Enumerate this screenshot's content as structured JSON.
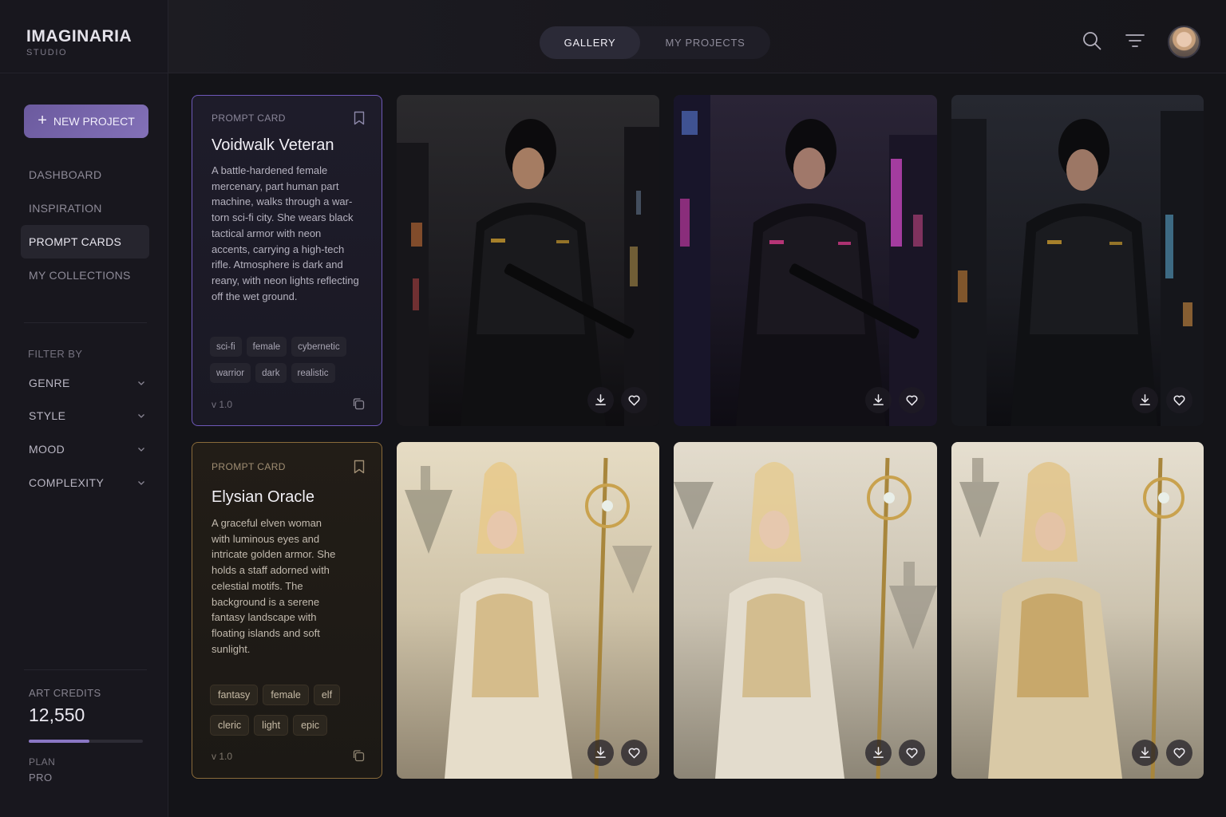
{
  "brand": {
    "name": "IMAGINARIA",
    "sub": "STUDIO"
  },
  "sidebar": {
    "new_project_label": "NEW PROJECT",
    "nav": [
      {
        "label": "DASHBOARD",
        "active": false
      },
      {
        "label": "INSPIRATION",
        "active": false
      },
      {
        "label": "PROMPT CARDS",
        "active": true
      },
      {
        "label": "MY COLLECTIONS",
        "active": false
      }
    ],
    "filter_title": "FILTER BY",
    "filters": [
      "GENRE",
      "STYLE",
      "MOOD",
      "COMPLEXITY"
    ],
    "credits_label": "ART CREDITS",
    "credits_value": "12,550",
    "credits_fraction": 0.53,
    "plan_label": "PLAN",
    "plan_value": "PRO"
  },
  "header": {
    "tabs": [
      {
        "label": "GALLERY",
        "active": true
      },
      {
        "label": "MY PROJECTS",
        "active": false
      }
    ],
    "icons": [
      "search-icon",
      "filter-icon",
      "avatar"
    ]
  },
  "prompt_cards": [
    {
      "kicker": "PROMPT CARD",
      "title": "Voidwalk Veteran",
      "description": "A battle-hardened female mercenary, part human part machine, walks through a war-torn sci-fi city. She wears black tactical armor with neon accents, carrying a high-tech rifle. Atmosphere is dark and reany, with neon lights reflecting off the wet ground.",
      "tags": [
        "sci-fi",
        "female",
        "cybernetic",
        "warrior",
        "dark",
        "realistic"
      ],
      "version": "v 1.0",
      "accent": "#6e58b8"
    },
    {
      "kicker": "PROMPT CARD",
      "title": "Elysian Oracle",
      "description": "A graceful elven woman with luminous eyes and intricate golden armor. She holds a staff adorned with celestial motifs. The background is a serene fantasy landscape with floating islands and soft sunlight.",
      "tags": [
        "fantasy",
        "female",
        "elf",
        "cleric",
        "light",
        "epic"
      ],
      "version": "v 1.0",
      "accent": "#8a6b3a"
    }
  ],
  "colors": {
    "accent": "#8371b8",
    "background": "#141418",
    "sidebar": "#18171e"
  }
}
